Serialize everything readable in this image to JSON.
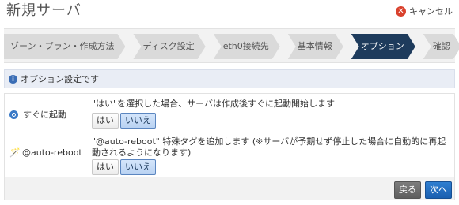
{
  "header": {
    "title": "新規サーバ",
    "cancel_label": "キャンセル"
  },
  "steps": [
    {
      "label": "ゾーン・プラン・作成方法",
      "active": false
    },
    {
      "label": "ディスク設定",
      "active": false
    },
    {
      "label": "eth0接続先",
      "active": false
    },
    {
      "label": "基本情報",
      "active": false
    },
    {
      "label": "オプション",
      "active": true
    },
    {
      "label": "確認",
      "active": false
    }
  ],
  "info": {
    "text": "オプション設定です"
  },
  "options": [
    {
      "label": "すぐに起動",
      "icon": "power-icon",
      "description": "\"はい\"を選択した場合、サーバは作成後すぐに起動開始します",
      "yes_label": "はい",
      "no_label": "いいえ",
      "selected": "no"
    },
    {
      "label": "@auto-reboot",
      "icon": "wand-icon",
      "description": "\"@auto-reboot\" 特殊タグを追加します (※サーバが予期せず停止した場合に自動的に再起動されるようになります)",
      "yes_label": "はい",
      "no_label": "いいえ",
      "selected": "no"
    }
  ],
  "footer": {
    "back_label": "戻る",
    "next_label": "次へ"
  },
  "colors": {
    "active_step": "#1e3b5c",
    "selected_button": "#b9d2f2",
    "next_button": "#1a5fb0",
    "cancel_icon": "#d9412d"
  }
}
